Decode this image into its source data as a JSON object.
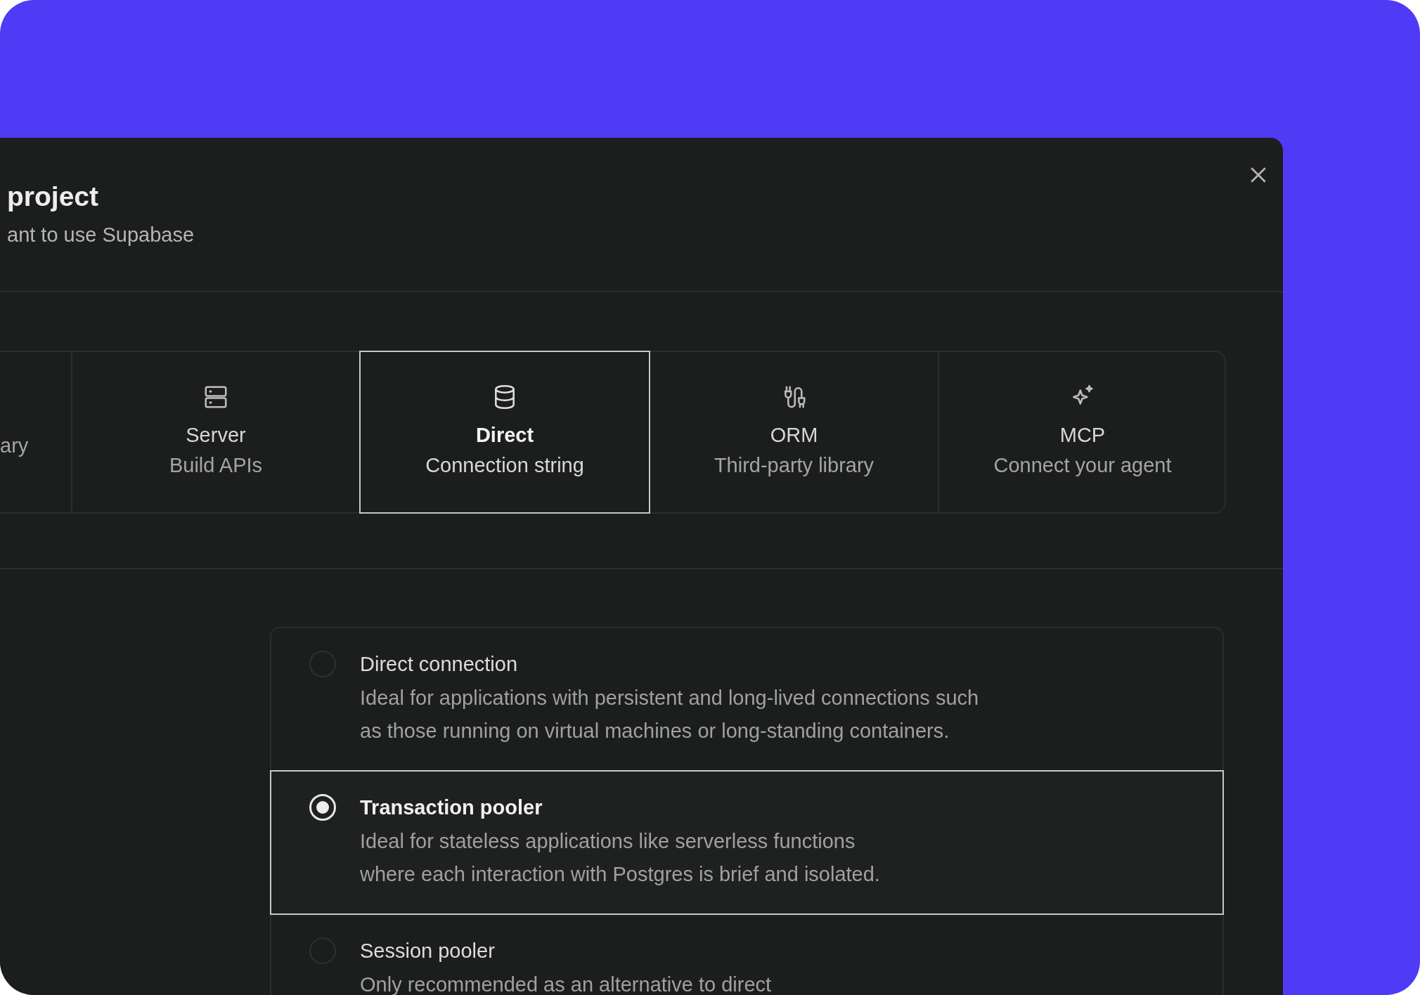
{
  "dialog": {
    "title": "project",
    "subtitle": "ant to use Supabase",
    "tabs": [
      {
        "kind": "partial",
        "description": "ary",
        "selected": false
      },
      {
        "kind": "server",
        "label": "Server",
        "description": "Build APIs",
        "selected": false
      },
      {
        "kind": "database",
        "label": "Direct",
        "description": "Connection string",
        "selected": true
      },
      {
        "kind": "orm",
        "label": "ORM",
        "description": "Third-party library",
        "selected": false
      },
      {
        "kind": "sparkle",
        "label": "MCP",
        "description": "Connect your agent",
        "selected": false
      }
    ],
    "connection_types": [
      {
        "title": "Direct connection",
        "description_lines": [
          "Ideal for applications with persistent and long-lived connections such",
          "as those running on virtual machines or long-standing containers."
        ],
        "selected": false
      },
      {
        "title": "Transaction pooler",
        "description_lines": [
          "Ideal for stateless applications like serverless functions",
          "where each interaction with Postgres is brief and isolated."
        ],
        "selected": true
      },
      {
        "title": "Session pooler",
        "description_lines": [
          "Only recommended as an alternative to direct"
        ],
        "selected": false
      }
    ]
  }
}
